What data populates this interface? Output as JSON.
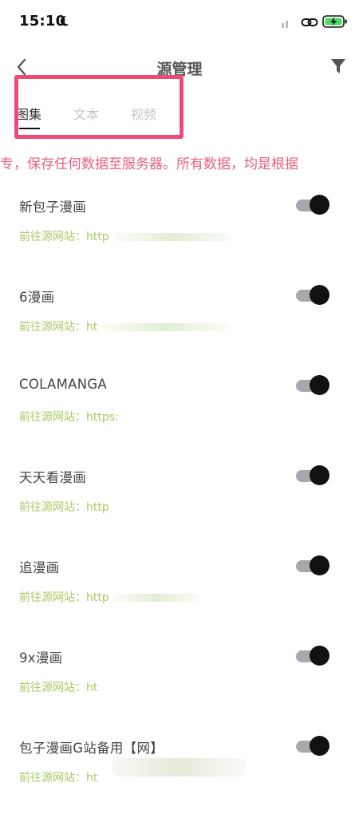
{
  "status_bar": {
    "time": "15:10",
    "icons": [
      "moon-icon",
      "signal-icon",
      "link-icon",
      "battery-charging-icon"
    ],
    "battery_color": "#4cd964"
  },
  "nav": {
    "title": "源管理",
    "back_icon": "chevron-left-icon",
    "filter_icon": "filter-icon"
  },
  "tabs": [
    {
      "label": "图集",
      "active": true
    },
    {
      "label": "文本",
      "active": false
    },
    {
      "label": "视频",
      "active": false
    }
  ],
  "notice": "专，保存任何数据至服务器。所有数据，均是根据",
  "url_prefix": "前往源网站：",
  "sources": [
    {
      "name": "新包子漫画",
      "url": "http",
      "enabled": true
    },
    {
      "name": "6漫画",
      "url": "ht",
      "enabled": true
    },
    {
      "name": "COLAMANGA",
      "url": "https:",
      "enabled": true
    },
    {
      "name": "天天看漫画",
      "url": "http",
      "enabled": true
    },
    {
      "name": "追漫画",
      "url": "http",
      "enabled": true
    },
    {
      "name": "9x漫画",
      "url": "ht",
      "enabled": true
    },
    {
      "name": "包子漫画G站备用【网】",
      "url": "ht",
      "enabled": true
    }
  ],
  "colors": {
    "highlight": "#ee4a76",
    "notice": "#e7617e",
    "url": "#a8c964",
    "toggle_track": "#a7a7ad",
    "toggle_knob": "#111111"
  }
}
